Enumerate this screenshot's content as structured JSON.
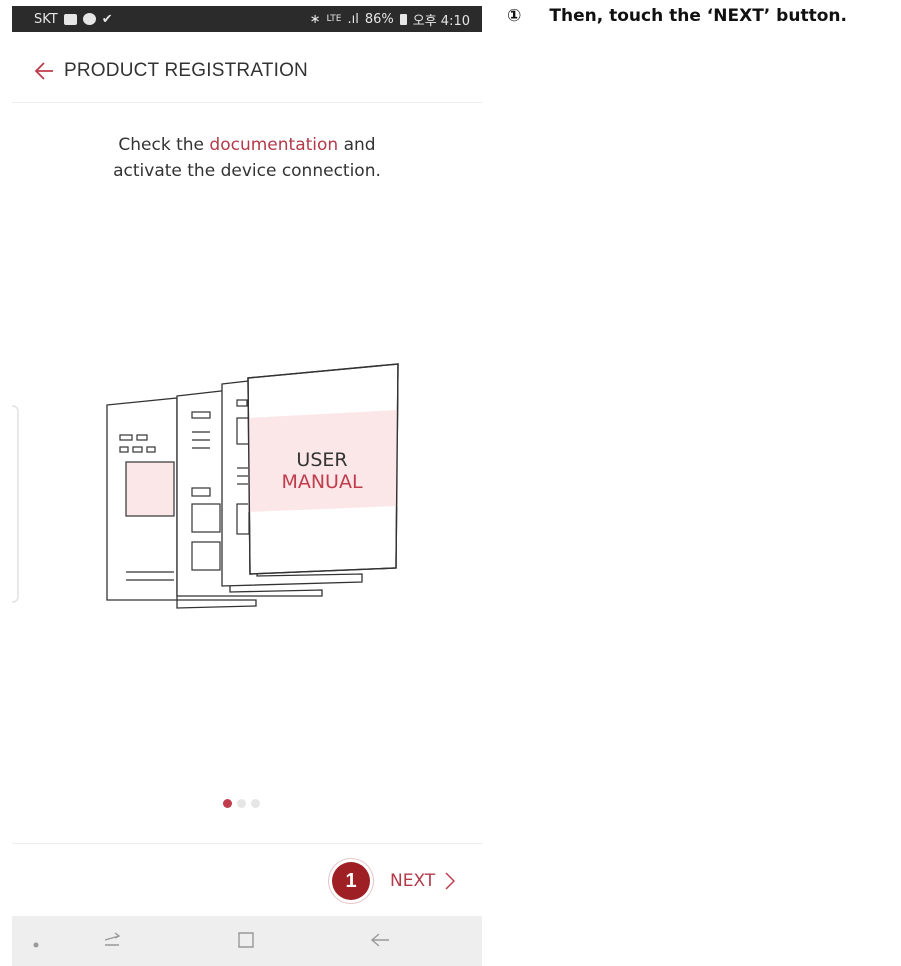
{
  "status_bar": {
    "carrier": "SKT",
    "network": "LTE",
    "battery": "86%",
    "time": "오후 4:10",
    "icons": [
      "gallery-icon",
      "chat-icon",
      "v-icon",
      "bluetooth-icon",
      "signal-icon",
      "battery-icon"
    ]
  },
  "header": {
    "title": "PRODUCT REGISTRATION"
  },
  "instruction": {
    "text_before": "Check the ",
    "link": "documentation",
    "text_after_line1": " and",
    "line2": "activate the device connection."
  },
  "illustration": {
    "line1": "USER",
    "line2": "MANUAL"
  },
  "pagination": {
    "total": 3,
    "current": 1
  },
  "footer": {
    "badge_number": "1",
    "next_label": "NEXT"
  },
  "navigation_bar": {
    "icons": [
      "dot-icon",
      "recent-apps-icon",
      "home-icon",
      "back-icon"
    ]
  },
  "annotation": {
    "marker": "①",
    "text": "Then, touch the ‘NEXT’ button."
  },
  "colors": {
    "accent": "#b33a49",
    "badge": "#9e1f24",
    "status_bar": "#2b2b2b"
  }
}
